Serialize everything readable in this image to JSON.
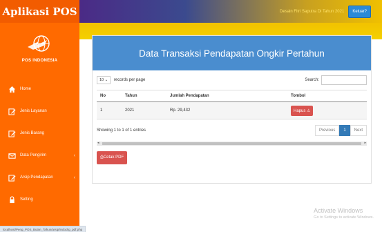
{
  "app": {
    "title": "Aplikasi POS"
  },
  "logo": {
    "text": "POS INDONESIA"
  },
  "sidebar": {
    "items": [
      {
        "label": "Home",
        "icon": "home-icon"
      },
      {
        "label": "Jenis Layanan",
        "icon": "edit-icon"
      },
      {
        "label": "Jenis Barang",
        "icon": "edit-icon"
      },
      {
        "label": "Data Pengirim",
        "icon": "envelope-icon"
      },
      {
        "label": "Arsip Pendapatan",
        "icon": "edit-icon"
      },
      {
        "label": "Setting",
        "icon": "lock-icon"
      }
    ]
  },
  "topbar": {
    "welcome": "Desain Fitri Saputra Di Tahun 2021",
    "logout_label": "Keluar?"
  },
  "panel": {
    "title": "Data Transaksi Pendapatan Ongkir Pertahun",
    "length_value": "10",
    "length_suffix": "records per page",
    "search_label": "Search:",
    "columns": [
      "No",
      "Tahun",
      "Jumlah Pendapatan",
      "Tombol"
    ],
    "rows": [
      {
        "no": "1",
        "tahun": "2021",
        "jumlah": "Rp. 29,432",
        "action": "Hapus"
      }
    ],
    "info": "Showing 1 to 1 of 1 entries",
    "pager": {
      "previous": "Previous",
      "page": "1",
      "next": "Next"
    },
    "pdf_label": "Cetak PDF"
  },
  "watermark": {
    "line1": "Activate Windows",
    "line2": "Go to Settings to activate Windows."
  },
  "status": {
    "url": "localhost/Peng_POS_Bulan_Tahun/arsip/indodrg_pdf.php"
  },
  "colors": {
    "sidebar": "#ff6a00",
    "header": "#4a8dcf",
    "danger": "#d9534f",
    "primary": "#337ab7"
  }
}
